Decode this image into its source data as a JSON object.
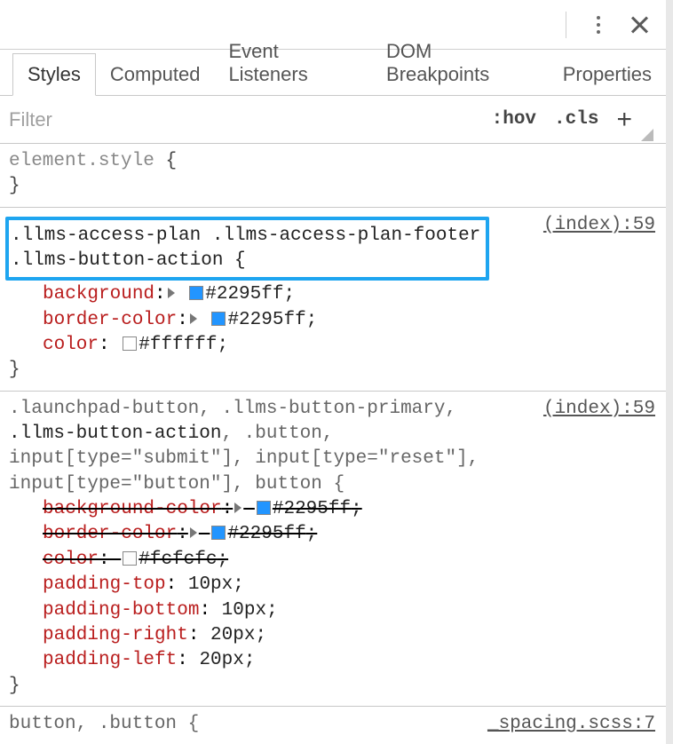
{
  "toolbar": {
    "kebab_name": "more-options",
    "close_name": "close-panel"
  },
  "tabs": [
    {
      "id": "styles",
      "label": "Styles",
      "active": true
    },
    {
      "id": "computed",
      "label": "Computed",
      "active": false
    },
    {
      "id": "event-listeners",
      "label": "Event Listeners",
      "active": false
    },
    {
      "id": "dom-breakpoints",
      "label": "DOM Breakpoints",
      "active": false
    },
    {
      "id": "properties",
      "label": "Properties",
      "active": false
    }
  ],
  "filter": {
    "placeholder": "Filter",
    "hov": ":hov",
    "cls": ".cls",
    "plus": "+"
  },
  "rules": [
    {
      "selector_plain": "element.style",
      "selector_strong": "",
      "source": "",
      "decls": []
    },
    {
      "selector_lines": [
        ".llms-access-plan .llms-access-plan-footer",
        ".llms-button-action {"
      ],
      "highlight": true,
      "source": "(index):59",
      "decls": [
        {
          "prop": "background",
          "tri": true,
          "swatch": "#2295ff",
          "val": "#2295ff",
          "strike": false
        },
        {
          "prop": "border-color",
          "tri": true,
          "swatch": "#2295ff",
          "val": "#2295ff",
          "strike": false
        },
        {
          "prop": "color",
          "tri": false,
          "swatch": "#ffffff",
          "val": "#ffffff",
          "strike": false
        }
      ]
    },
    {
      "selector_html": ".launchpad-button, .llms-button-primary,\n<strong>.llms-button-action</strong>, .button,\ninput[type=\"submit\"], input[type=\"reset\"],\ninput[type=\"button\"], button {",
      "source": "(index):59",
      "decls": [
        {
          "prop": "background-color",
          "tri": true,
          "swatch": "#2295ff",
          "val": "#2295ff",
          "strike": true
        },
        {
          "prop": "border-color",
          "tri": true,
          "swatch": "#2295ff",
          "val": "#2295ff",
          "strike": true
        },
        {
          "prop": "color",
          "tri": false,
          "swatch": "#fcfcfc",
          "val": "#fcfcfc",
          "strike": true
        },
        {
          "prop": "padding-top",
          "tri": false,
          "swatch": "",
          "val": "10px",
          "strike": false
        },
        {
          "prop": "padding-bottom",
          "tri": false,
          "swatch": "",
          "val": "10px",
          "strike": false
        },
        {
          "prop": "padding-right",
          "tri": false,
          "swatch": "",
          "val": "20px",
          "strike": false
        },
        {
          "prop": "padding-left",
          "tri": false,
          "swatch": "",
          "val": "20px",
          "strike": false
        }
      ]
    },
    {
      "selector_plain": "button, .button {",
      "source": "_spacing.scss:7",
      "decls": []
    }
  ]
}
